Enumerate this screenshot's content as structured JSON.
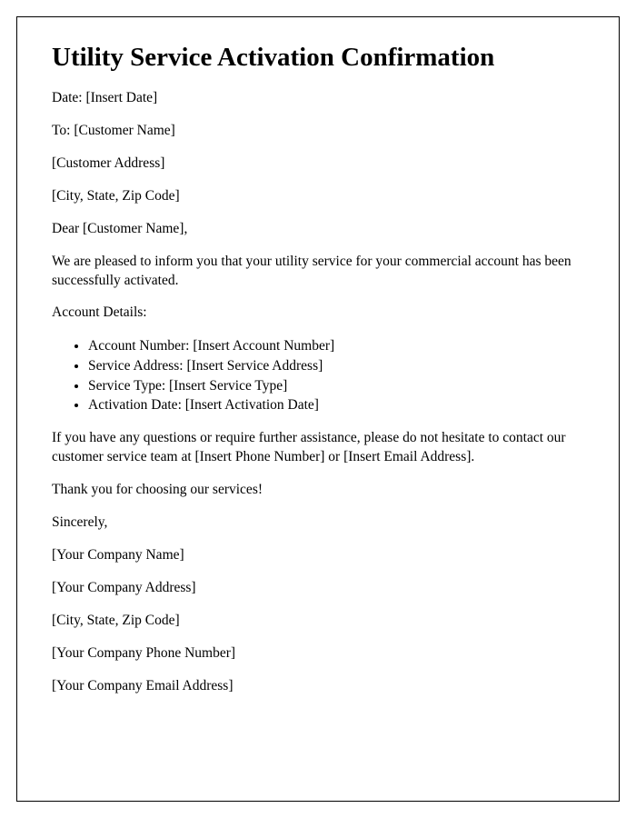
{
  "title": "Utility Service Activation Confirmation",
  "date_line": "Date: [Insert Date]",
  "to_line": "To: [Customer Name]",
  "customer_address": "[Customer Address]",
  "customer_city_state_zip": "[City, State, Zip Code]",
  "salutation": "Dear [Customer Name],",
  "intro": "We are pleased to inform you that your utility service for your commercial account has been successfully activated.",
  "account_details_label": "Account Details:",
  "details": {
    "account_number": "Account Number: [Insert Account Number]",
    "service_address": "Service Address: [Insert Service Address]",
    "service_type": "Service Type: [Insert Service Type]",
    "activation_date": "Activation Date: [Insert Activation Date]"
  },
  "assistance": "If you have any questions or require further assistance, please do not hesitate to contact our customer service team at [Insert Phone Number] or [Insert Email Address].",
  "thanks": "Thank you for choosing our services!",
  "closing": "Sincerely,",
  "company_name": "[Your Company Name]",
  "company_address": "[Your Company Address]",
  "company_city_state_zip": "[City, State, Zip Code]",
  "company_phone": "[Your Company Phone Number]",
  "company_email": "[Your Company Email Address]"
}
